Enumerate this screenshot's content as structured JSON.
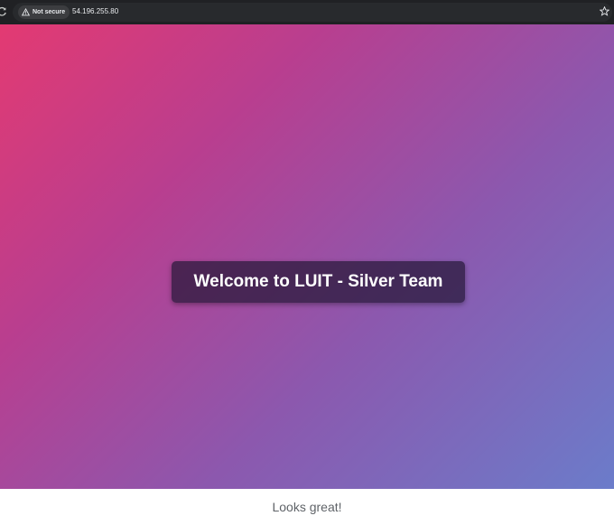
{
  "browser": {
    "security_label": "Not secure",
    "url": "54.196.255.80",
    "icons": {
      "reload": "reload-icon",
      "security": "warning-icon",
      "bookmark": "star-icon"
    }
  },
  "page": {
    "welcome_text": "Welcome to LUIT - Silver Team",
    "gradient_colors": [
      "#e33a72",
      "#b93e8f",
      "#8c58ae",
      "#6b7cca"
    ],
    "card_color": "#2a1a3c"
  },
  "caption": "Looks great!"
}
